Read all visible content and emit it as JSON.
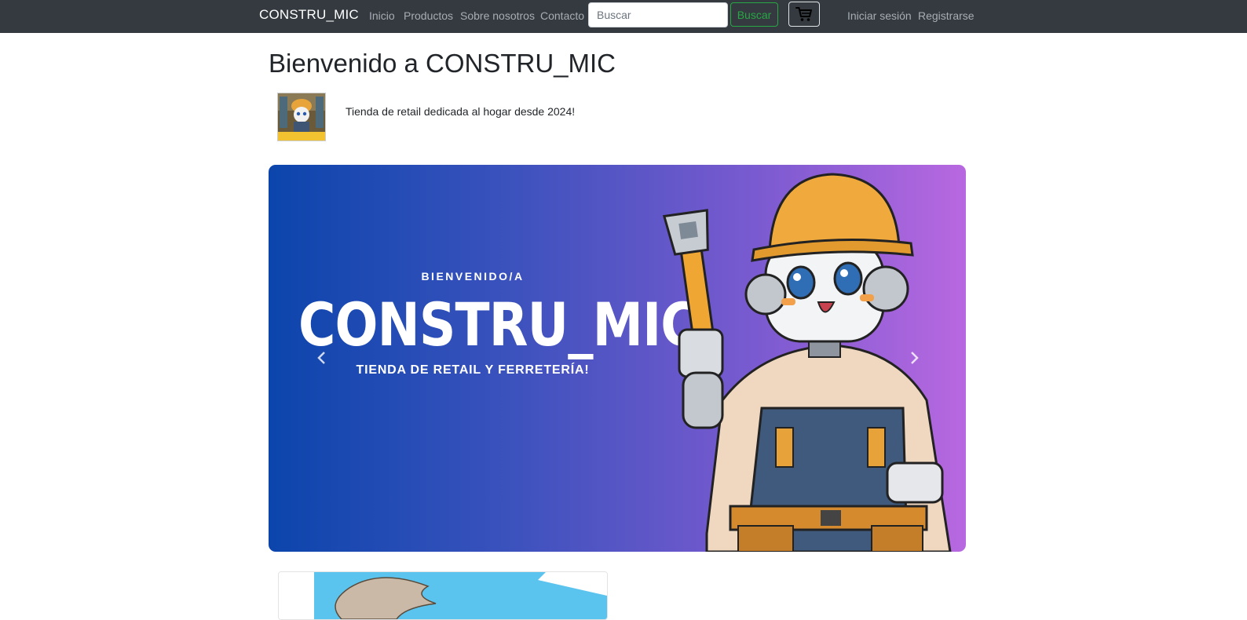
{
  "navbar": {
    "brand": "CONSTRU_MIC",
    "links": [
      "Inicio",
      "Productos",
      "Sobre nosotros",
      "Contacto"
    ],
    "search_placeholder": "Buscar",
    "search_button": "Buscar",
    "cart_icon": "shopping-cart-icon",
    "auth": [
      "Iniciar sesión",
      "Registrarse"
    ]
  },
  "main": {
    "title": "Bienvenido a CONSTRU_MIC",
    "tagline": "Tienda de retail dedicada al hogar desde 2024!",
    "logo_text": "CONSTRU_MIC"
  },
  "carousel": {
    "small_heading": "BIENVENIDO/A",
    "big_heading": "CONSTRU_MIC",
    "subheading": "TIENDA DE RETAIL Y FERRETERÍA!",
    "prev_icon": "chevron-left-icon",
    "next_icon": "chevron-right-icon"
  },
  "colors": {
    "navbar_bg": "#343a40",
    "search_button": "#28a745",
    "banner_start": "#0b45ac",
    "banner_end": "#b868e0"
  }
}
